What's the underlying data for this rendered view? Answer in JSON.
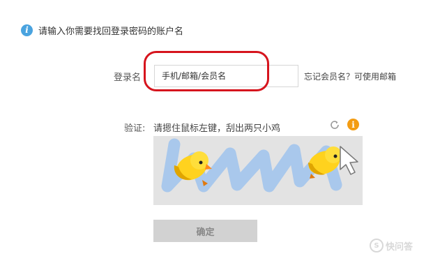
{
  "prompt": {
    "text": "请输入你需要找回登录密码的账户名",
    "icon": "info-icon"
  },
  "login": {
    "label": "登录名",
    "placeholder": "手机/邮箱/会员名",
    "forgot_link": "忘记会员名？可使用邮箱"
  },
  "verify": {
    "label": "验证:",
    "hint": "请摁住鼠标左键，刮出两只小鸡",
    "refresh_icon": "refresh-icon",
    "tip_icon": "warning-info-icon",
    "tip_glyph": "i"
  },
  "captcha": {
    "description_icons": [
      "chick-icon",
      "chick-icon",
      "cursor-icon"
    ],
    "scratch_color": "#a9c8ec",
    "background": "#e3e3e3"
  },
  "confirm_button": {
    "label": "确定"
  },
  "watermark": {
    "glyph": "S",
    "text": "快问答"
  },
  "colors": {
    "accent_red": "#d6141d",
    "info_blue": "#4aa3df",
    "tip_orange": "#f39c12"
  }
}
